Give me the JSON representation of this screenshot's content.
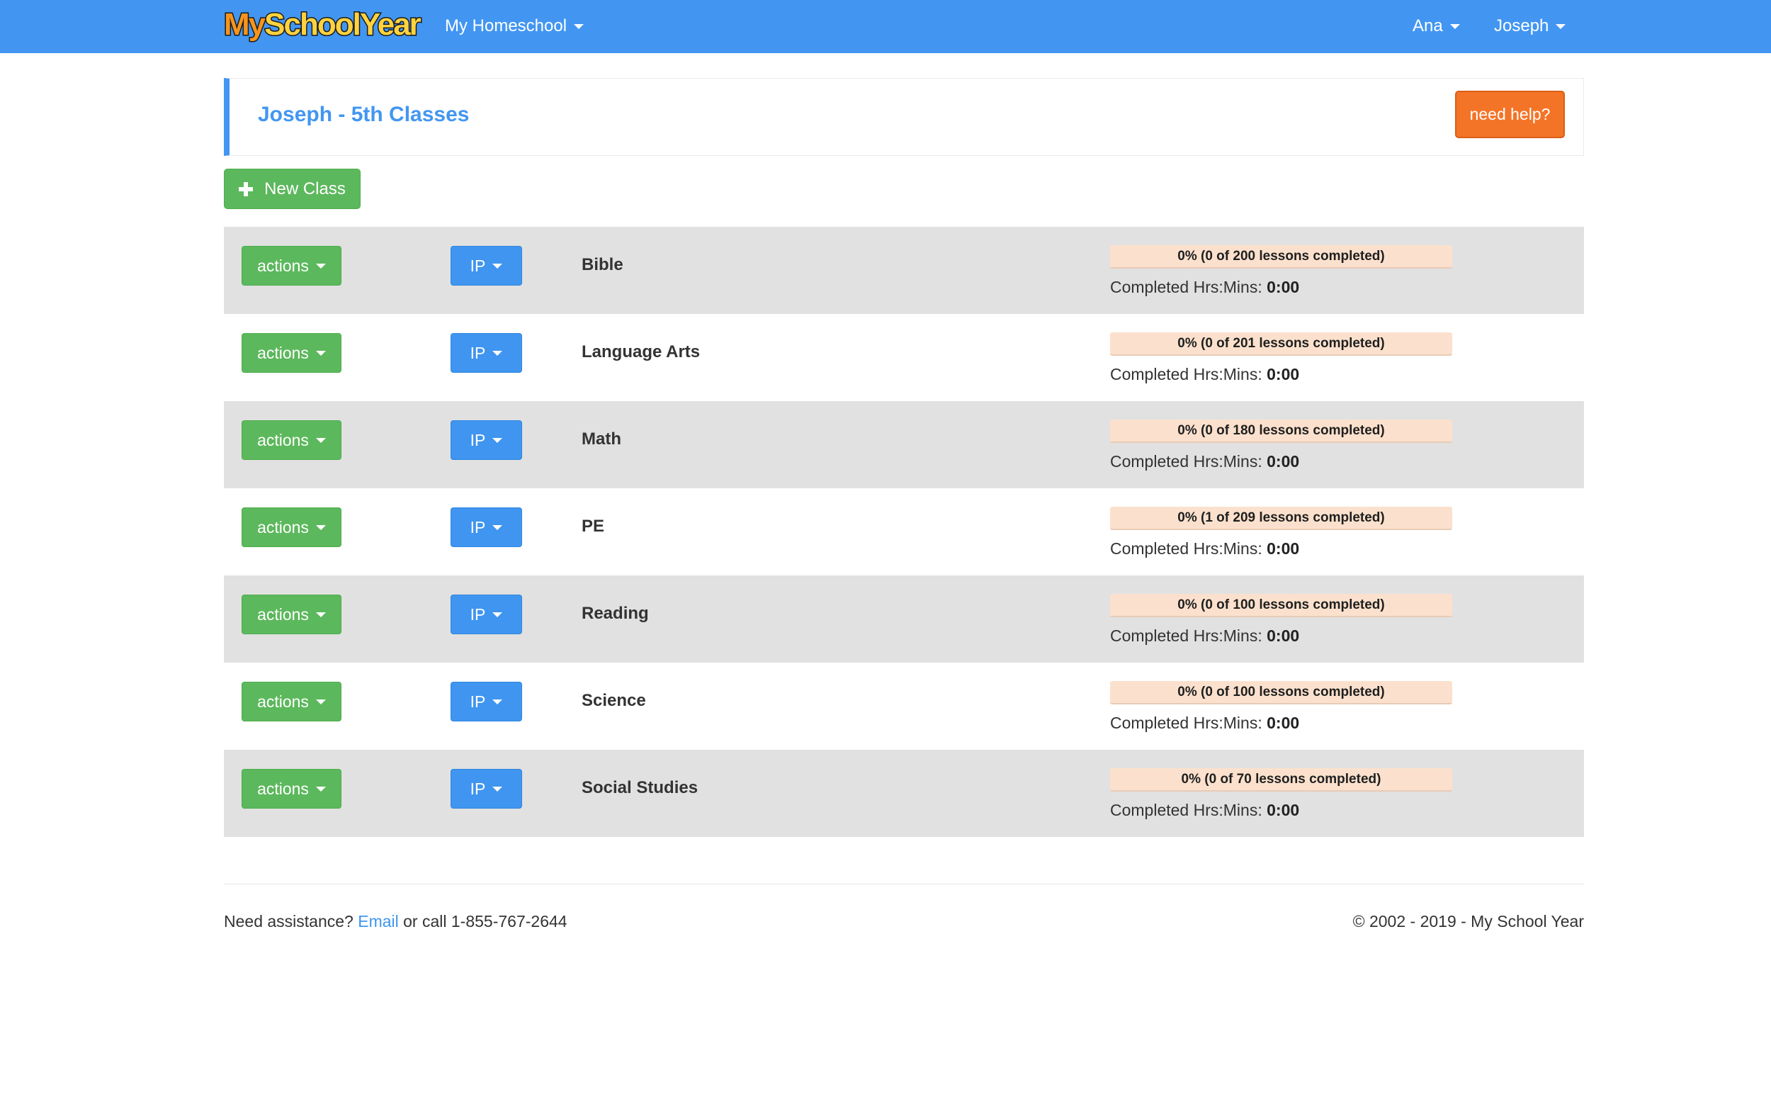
{
  "navbar": {
    "logo": {
      "part1": "My",
      "part2": "School",
      "part3": "Year"
    },
    "homeschool_label": "My Homeschool",
    "user_label": "Ana",
    "student_label": "Joseph"
  },
  "header": {
    "title": "Joseph - 5th Classes",
    "help_label": "need help?"
  },
  "new_class_label": "New Class",
  "classes": [
    {
      "actions_label": "actions",
      "status_label": "IP",
      "name": "Bible",
      "progress_fraction": 0,
      "progress_label": "0% (0 of 200 lessons completed)",
      "hours_label": "Completed Hrs:Mins:",
      "hours_value": "0:00"
    },
    {
      "actions_label": "actions",
      "status_label": "IP",
      "name": "Language Arts",
      "progress_fraction": 0,
      "progress_label": "0% (0 of 201 lessons completed)",
      "hours_label": "Completed Hrs:Mins:",
      "hours_value": "0:00"
    },
    {
      "actions_label": "actions",
      "status_label": "IP",
      "name": "Math",
      "progress_fraction": 0,
      "progress_label": "0% (0 of 180 lessons completed)",
      "hours_label": "Completed Hrs:Mins:",
      "hours_value": "0:00"
    },
    {
      "actions_label": "actions",
      "status_label": "IP",
      "name": "PE",
      "progress_fraction": 0,
      "progress_label": "0% (1 of 209 lessons completed)",
      "hours_label": "Completed Hrs:Mins:",
      "hours_value": "0:00"
    },
    {
      "actions_label": "actions",
      "status_label": "IP",
      "name": "Reading",
      "progress_fraction": 0,
      "progress_label": "0% (0 of 100 lessons completed)",
      "hours_label": "Completed Hrs:Mins:",
      "hours_value": "0:00"
    },
    {
      "actions_label": "actions",
      "status_label": "IP",
      "name": "Science",
      "progress_fraction": 0,
      "progress_label": "0% (0 of 100 lessons completed)",
      "hours_label": "Completed Hrs:Mins:",
      "hours_value": "0:00"
    },
    {
      "actions_label": "actions",
      "status_label": "IP",
      "name": "Social Studies",
      "progress_fraction": 0,
      "progress_label": "0% (0 of 70 lessons completed)",
      "hours_label": "Completed Hrs:Mins:",
      "hours_value": "0:00"
    }
  ],
  "footer": {
    "assist_prefix": "Need assistance?",
    "email_link": "Email",
    "assist_suffix": "or call 1-855-767-2644",
    "copyright": "© 2002 - 2019 - My School Year"
  },
  "colors": {
    "navbar_blue": "#4296f2",
    "action_green": "#5cb85c",
    "ip_blue": "#3f95ef",
    "help_orange": "#f47427",
    "progress_track": "#fbe1cd"
  },
  "icons": {
    "dropdown": "caret-down-icon",
    "new_class": "plus-icon"
  }
}
